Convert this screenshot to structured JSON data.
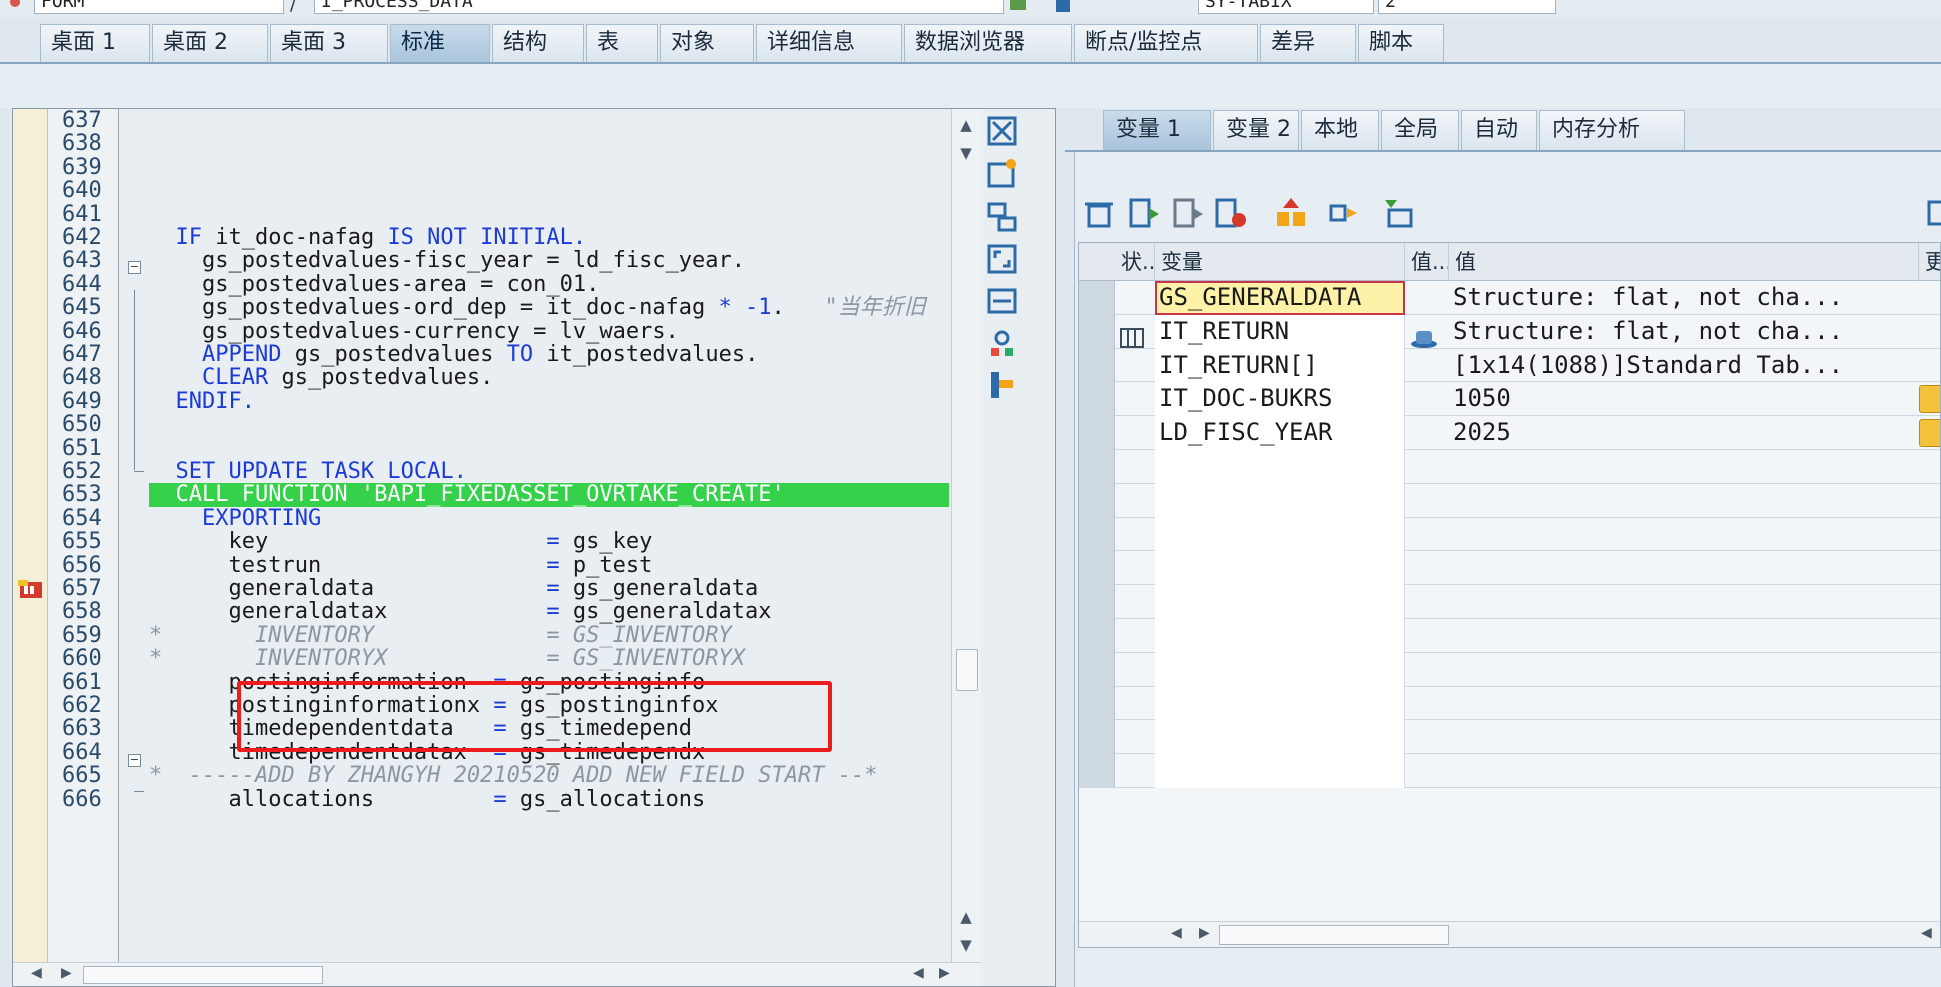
{
  "top": {
    "field1": "FORM",
    "field2": "I_PROCESS_DATA",
    "field3": "SY-TABIX",
    "field4": "2"
  },
  "tabs": [
    "桌面 1",
    "桌面 2",
    "桌面 3",
    "标准",
    "结构",
    "表",
    "对象",
    "详细信息",
    "数据浏览器",
    "断点/监控点",
    "差异",
    "脚本"
  ],
  "active_tab": "标准",
  "editor": {
    "line_numbers": [
      "637",
      "638",
      "639",
      "640",
      "641",
      "642",
      "643",
      "644",
      "645",
      "646",
      "647",
      "648",
      "649",
      "650",
      "651",
      "652",
      "653",
      "654",
      "655",
      "656",
      "657",
      "658",
      "659",
      "660",
      "661",
      "662",
      "663",
      "664",
      "665",
      "666"
    ],
    "current_line": "653",
    "lines": [
      {
        "parts": []
      },
      {
        "parts": []
      },
      {
        "parts": []
      },
      {
        "parts": []
      },
      {
        "parts": []
      },
      {
        "parts": [
          {
            "t": "  "
          },
          {
            "t": "IF",
            "k": "kw"
          },
          {
            "t": " it_doc-nafag "
          },
          {
            "t": "IS NOT INITIAL.",
            "k": "kw"
          }
        ]
      },
      {
        "parts": [
          {
            "t": "    gs_postedvalues-fisc_year = ld_fisc_year."
          }
        ]
      },
      {
        "parts": [
          {
            "t": "    gs_postedvalues-area = con_01."
          }
        ]
      },
      {
        "parts": [
          {
            "t": "    gs_postedvalues-ord_dep = it_doc-nafag "
          },
          {
            "t": "*",
            "k": "kw"
          },
          {
            "t": " "
          },
          {
            "t": "-1",
            "k": "kw"
          },
          {
            "t": ".   "
          },
          {
            "t": "\"当年折旧",
            "k": "cm"
          }
        ]
      },
      {
        "parts": [
          {
            "t": "    gs_postedvalues-currency = lv_waers."
          }
        ]
      },
      {
        "parts": [
          {
            "t": "    "
          },
          {
            "t": "APPEND",
            "k": "kw"
          },
          {
            "t": " gs_postedvalues "
          },
          {
            "t": "TO",
            "k": "kw"
          },
          {
            "t": " it_postedvalues."
          }
        ]
      },
      {
        "parts": [
          {
            "t": "    "
          },
          {
            "t": "CLEAR",
            "k": "kw"
          },
          {
            "t": " gs_postedvalues."
          }
        ]
      },
      {
        "parts": [
          {
            "t": "  "
          },
          {
            "t": "ENDIF.",
            "k": "kw"
          }
        ]
      },
      {
        "parts": []
      },
      {
        "parts": []
      },
      {
        "parts": [
          {
            "t": "  "
          },
          {
            "t": "SET UPDATE TASK LOCAL.",
            "k": "kw"
          }
        ]
      },
      {
        "parts": [
          {
            "t": "  CALL FUNCTION 'BAPI_FIXEDASSET_OVRTAKE_CREATE'"
          }
        ],
        "hl": true
      },
      {
        "parts": [
          {
            "t": "    "
          },
          {
            "t": "EXPORTING",
            "k": "kw"
          }
        ]
      },
      {
        "parts": [
          {
            "t": "      key                     "
          },
          {
            "t": "=",
            "k": "kw"
          },
          {
            "t": " gs_key"
          }
        ]
      },
      {
        "parts": [
          {
            "t": "      testrun                 "
          },
          {
            "t": "=",
            "k": "kw"
          },
          {
            "t": " p_test"
          }
        ]
      },
      {
        "parts": [
          {
            "t": "      generaldata             "
          },
          {
            "t": "=",
            "k": "kw"
          },
          {
            "t": " gs_generaldata"
          }
        ]
      },
      {
        "parts": [
          {
            "t": "      generaldatax            "
          },
          {
            "t": "=",
            "k": "kw"
          },
          {
            "t": " gs_generaldatax"
          }
        ]
      },
      {
        "parts": [
          {
            "t": "*       INVENTORY             = GS_INVENTORY",
            "k": "cm"
          }
        ]
      },
      {
        "parts": [
          {
            "t": "*       INVENTORYX            = GS_INVENTORYX",
            "k": "cm"
          }
        ]
      },
      {
        "parts": [
          {
            "t": "      postinginformation  "
          },
          {
            "t": "=",
            "k": "kw"
          },
          {
            "t": " gs_postinginfo"
          }
        ]
      },
      {
        "parts": [
          {
            "t": "      postinginformationx "
          },
          {
            "t": "=",
            "k": "kw"
          },
          {
            "t": " gs_postinginfox"
          }
        ]
      },
      {
        "parts": [
          {
            "t": "      timedependentdata   "
          },
          {
            "t": "=",
            "k": "kw"
          },
          {
            "t": " gs_timedepend"
          }
        ]
      },
      {
        "parts": [
          {
            "t": "      timedependentdatax  "
          },
          {
            "t": "=",
            "k": "kw"
          },
          {
            "t": " gs_timedependx"
          }
        ]
      },
      {
        "parts": [
          {
            "t": "*  -----ADD BY ZHANGYH 20210520 ADD NEW FIELD START --*",
            "k": "cm"
          }
        ]
      },
      {
        "parts": [
          {
            "t": "      allocations         "
          },
          {
            "t": "=",
            "k": "kw"
          },
          {
            "t": " gs_allocations"
          }
        ]
      }
    ]
  },
  "right_tabs": [
    "变量 1",
    "变量 2",
    "本地",
    "全局",
    "自动",
    "内存分析"
  ],
  "right_active_tab": "变量 1",
  "grid": {
    "headers": [
      "状...",
      "变量",
      "值...",
      "值",
      "更"
    ],
    "rows": [
      {
        "name": "GS_GENERALDATA",
        "value": "Structure: flat, not cha...",
        "selected": true
      },
      {
        "name": "IT_RETURN",
        "value": "Structure: flat, not cha...",
        "icon": true
      },
      {
        "name": "IT_RETURN[]",
        "value": "[1x14(1088)]Standard Tab..."
      },
      {
        "name": "IT_DOC-BUKRS",
        "value": "1050",
        "editable": true
      },
      {
        "name": "LD_FISC_YEAR",
        "value": "2025",
        "editable": true
      }
    ],
    "empty_rows": 10
  },
  "colors": {
    "highlight_line": "#35d14a",
    "keyword": "#1c3bd6",
    "comment": "#8d97a3",
    "annotation_box": "#ec1c1c",
    "selected_cell": "#fdf2a8"
  }
}
